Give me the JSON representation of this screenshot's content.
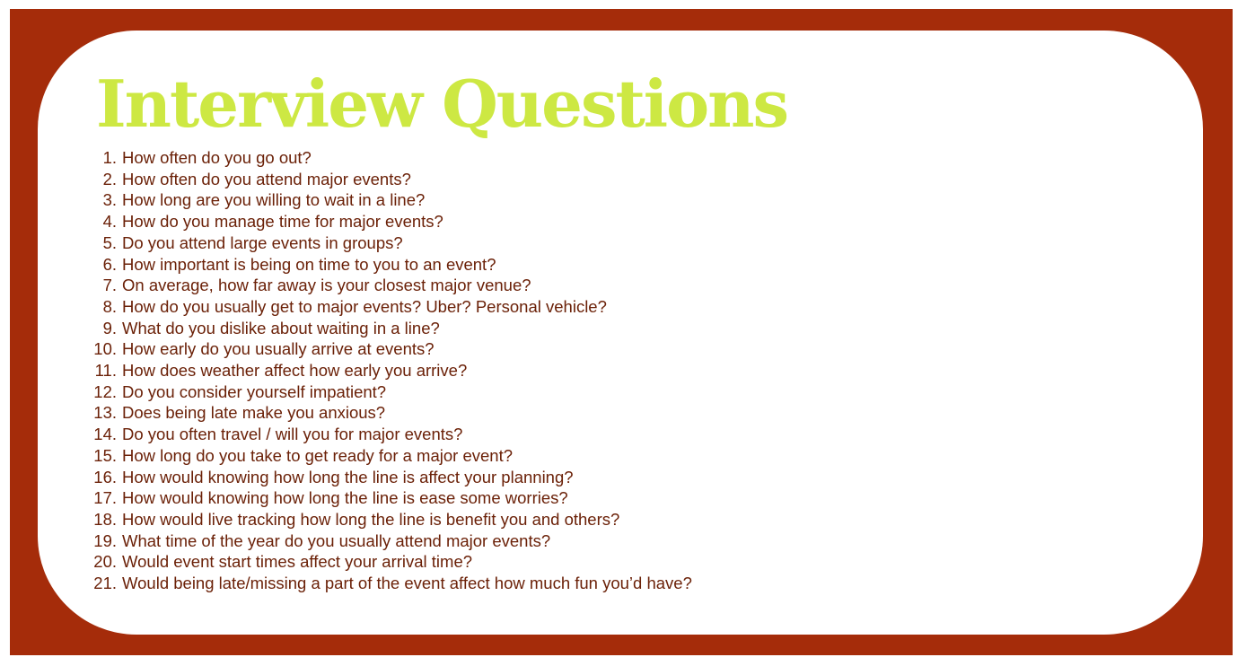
{
  "title": "Interview Questions",
  "colors": {
    "frame": "#a52c0a",
    "title": "#cde843",
    "text": "#6b2108",
    "card": "#ffffff"
  },
  "questions": [
    {
      "number": "1.",
      "text": "How often do you go out?"
    },
    {
      "number": "2.",
      "text": "How often do you attend major events?"
    },
    {
      "number": "3.",
      "text": "How long are you willing to wait in a line?"
    },
    {
      "number": "4.",
      "text": "How do you manage time for major events?"
    },
    {
      "number": "5.",
      "text": "Do you attend large events in groups?"
    },
    {
      "number": "6.",
      "text": "How important is being on time to you to an event?"
    },
    {
      "number": "7.",
      "text": "On average, how far away is your closest major venue?"
    },
    {
      "number": "8.",
      "text": "How do you usually get to major events? Uber? Personal vehicle?"
    },
    {
      "number": "9.",
      "text": "What do you dislike about waiting in a line?"
    },
    {
      "number": "10.",
      "text": "How early do you usually arrive at events?"
    },
    {
      "number": "11.",
      "text": "How does weather affect how early you arrive?"
    },
    {
      "number": "12.",
      "text": "Do you consider yourself impatient?"
    },
    {
      "number": "13.",
      "text": "Does being late make you anxious?"
    },
    {
      "number": "14.",
      "text": "Do you often travel / will you for major events?"
    },
    {
      "number": "15.",
      "text": "How long do you take to get ready for a major event?"
    },
    {
      "number": "16.",
      "text": "How would knowing how long the line is affect your planning?"
    },
    {
      "number": "17.",
      "text": "How would knowing how long the line is ease some worries?"
    },
    {
      "number": "18.",
      "text": "How would live tracking how long the line is benefit you and others?"
    },
    {
      "number": "19.",
      "text": "What time of the year do you usually attend major events?"
    },
    {
      "number": "20.",
      "text": "Would event start times affect your arrival time?"
    },
    {
      "number": "21.",
      "text": "Would being late/missing a part of the event affect how much fun you’d have?"
    }
  ]
}
